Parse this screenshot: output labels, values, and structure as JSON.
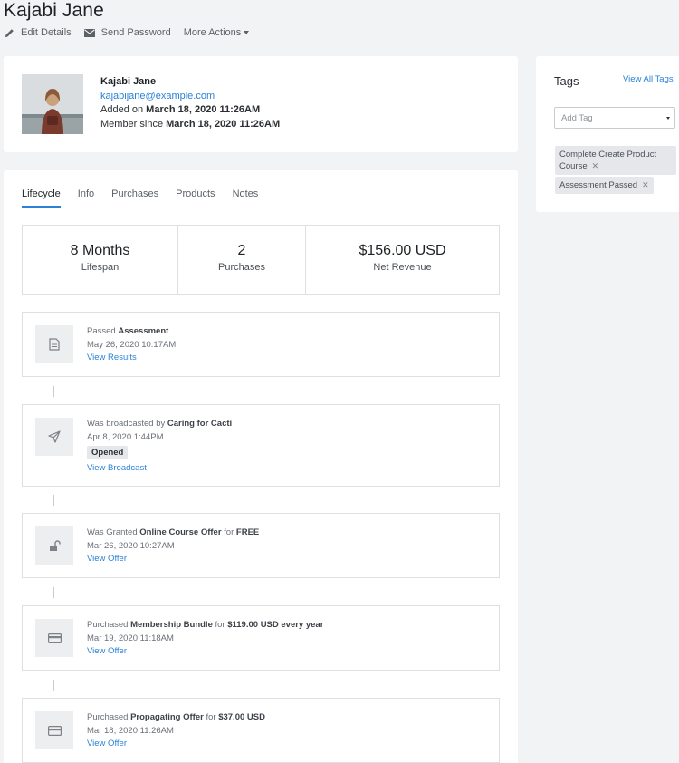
{
  "page": {
    "title": "Kajabi Jane"
  },
  "actions": {
    "edit": "Edit Details",
    "send_password": "Send Password",
    "more": "More Actions"
  },
  "profile": {
    "name": "Kajabi Jane",
    "email": "kajabijane@example.com",
    "added_prefix": "Added on",
    "added_date": "March 18, 2020 11:26AM",
    "member_prefix": "Member since",
    "member_date": "March 18, 2020 11:26AM"
  },
  "tags": {
    "title": "Tags",
    "view_all": "View All Tags",
    "placeholder": "Add Tag",
    "items": [
      {
        "line1": "Complete Create Product",
        "line2": "Course"
      },
      {
        "line1": "Assessment Passed"
      }
    ]
  },
  "tabs": [
    "Lifecycle",
    "Info",
    "Purchases",
    "Products",
    "Notes"
  ],
  "stats": [
    {
      "value": "8 Months",
      "label": "Lifespan"
    },
    {
      "value": "2",
      "label": "Purchases"
    },
    {
      "value": "$156.00 USD",
      "label": "Net Revenue"
    }
  ],
  "events": [
    {
      "icon": "document-icon",
      "prefix": "Passed",
      "bold": "Assessment",
      "date": "May 26, 2020 10:17AM",
      "link": "View Results"
    },
    {
      "icon": "paper-plane-icon",
      "prefix": "Was broadcasted by",
      "bold": "Caring for Cacti",
      "date": "Apr 8, 2020 1:44PM",
      "badge": "Opened",
      "link": "View Broadcast"
    },
    {
      "icon": "unlock-icon",
      "prefix": "Was Granted",
      "bold": "Online Course Offer",
      "mid": "for",
      "bold2": "FREE",
      "date": "Mar 26, 2020 10:27AM",
      "link": "View Offer"
    },
    {
      "icon": "credit-card-icon",
      "prefix": "Purchased",
      "bold": "Membership Bundle",
      "mid": "for",
      "bold2": "$119.00 USD every year",
      "date": "Mar 19, 2020 11:18AM",
      "link": "View Offer"
    },
    {
      "icon": "credit-card-icon",
      "prefix": "Purchased",
      "bold": "Propagating Offer",
      "mid": "for",
      "bold2": "$37.00 USD",
      "date": "Mar 18, 2020 11:26AM",
      "link": "View Offer"
    }
  ]
}
